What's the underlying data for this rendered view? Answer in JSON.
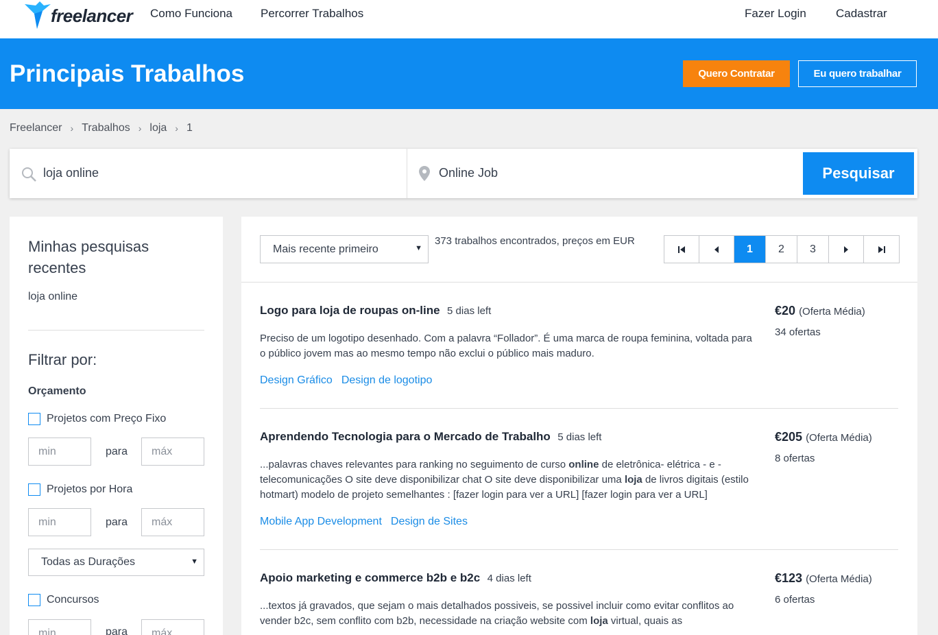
{
  "nav": {
    "brand": "freelancer",
    "links": [
      "Como Funciona",
      "Percorrer Trabalhos"
    ],
    "login": "Fazer Login",
    "signup": "Cadastrar"
  },
  "hero": {
    "title": "Principais Trabalhos",
    "hire_label": "Quero Contratar",
    "work_label": "Eu quero trabalhar"
  },
  "breadcrumb": [
    "Freelancer",
    "Trabalhos",
    "loja",
    "1"
  ],
  "search": {
    "query": "loja online",
    "location": "Online Job",
    "button": "Pesquisar"
  },
  "sidebar": {
    "recent_title": "Minhas pesquisas recentes",
    "recent_item": "loja online",
    "filter_title": "Filtrar por:",
    "budget_title": "Orçamento",
    "fixed_label": "Projetos com Preço Fixo",
    "hourly_label": "Projetos por Hora",
    "min_placeholder": "min",
    "max_placeholder": "máx",
    "range_sep": "para",
    "duration": "Todas as Durações",
    "contests_label": "Concursos"
  },
  "results": {
    "sort": "Mais recente primeiro",
    "count_text": "373 trabalhos encontrados, preços em EUR",
    "pages": [
      "1",
      "2",
      "3"
    ],
    "current_page": "1"
  },
  "jobs": [
    {
      "title": "Logo para loja de roupas on-line",
      "days": "5 dias left",
      "price": "€20",
      "price_note": "(Oferta Média)",
      "bids": "34 ofertas",
      "desc": "Preciso de um logotipo desenhado. Com a palavra “Follador”. É uma marca de roupa feminina, voltada para o público jovem mas ao mesmo tempo não exclui o público mais maduro.",
      "tags": [
        "Design Gráfico",
        "Design de logotipo"
      ]
    },
    {
      "title": "Aprendendo Tecnologia para o Mercado de Trabalho",
      "days": "5 dias left",
      "price": "€205",
      "price_note": "(Oferta Média)",
      "bids": "8 ofertas",
      "desc_parts": [
        "...palavras chaves relevantes para ranking no seguimento de curso ",
        "online",
        " de eletrônica- elétrica - e - telecomunicações O site deve disponibilizar chat O site deve disponibilizar uma ",
        "loja",
        " de livros digitais (estilo hotmart) modelo de projeto semelhantes : [fazer login para ver a URL] [fazer login para ver a URL]"
      ],
      "tags": [
        "Mobile App Development",
        "Design de Sites"
      ]
    },
    {
      "title": "Apoio marketing e commerce b2b e b2c",
      "days": "4 dias left",
      "price": "€123",
      "price_note": "(Oferta Média)",
      "bids": "6 ofertas",
      "desc_parts": [
        "...textos já gravados, que sejam o mais detalhados possiveis, se possivel incluir como evitar conflitos ao vender b2c, sem conflito com b2b, necessidade na criação website com ",
        "loja",
        " virtual, quais as"
      ]
    }
  ],
  "colors": {
    "primary": "#0e8bf1",
    "orange": "#f7830e",
    "link": "#1a8ce6"
  }
}
